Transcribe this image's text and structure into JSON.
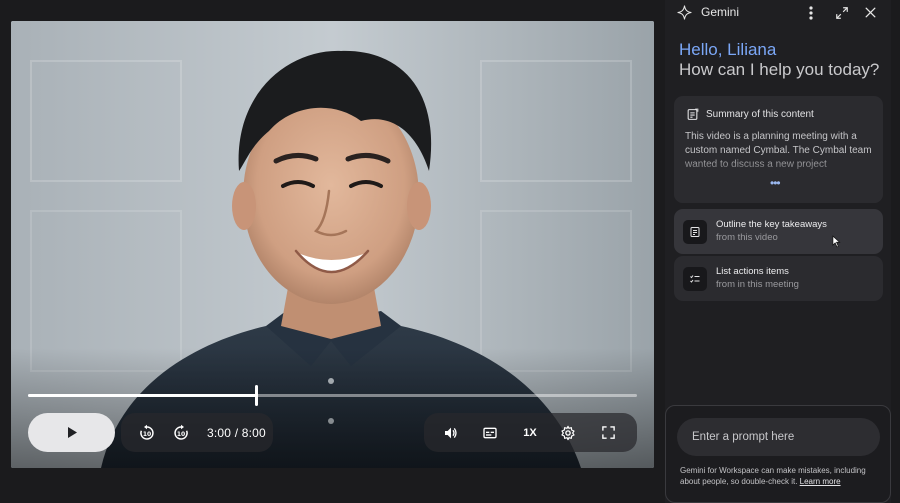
{
  "video": {
    "time_display": "3:00 / 8:00",
    "speed_label": "1X",
    "progress_fraction": 0.375
  },
  "panel": {
    "title": "Gemini",
    "greeting_name": "Hello, Liliana",
    "greeting_question": "How can I help you today?",
    "summary": {
      "title": "Summary of this content",
      "text": "This video is a planning meeting with a custom named Cymbal. The Cymbal team wanted to discuss a new project",
      "more": "•••"
    },
    "suggestions": [
      {
        "title": "Outline the key takeaways",
        "subtitle": "from this video"
      },
      {
        "title": "List actions items",
        "subtitle": "from in this meeting"
      }
    ],
    "prompt": {
      "placeholder": "Enter a prompt here",
      "disclaimer": "Gemini for Workspace can make mistakes, including about people, so double-check it.",
      "learn_more": "Learn more"
    }
  },
  "colors": {
    "accent_blue": "#7ba7f7",
    "panel_bg": "#1f1f22",
    "card_bg": "#2b2b2f"
  }
}
